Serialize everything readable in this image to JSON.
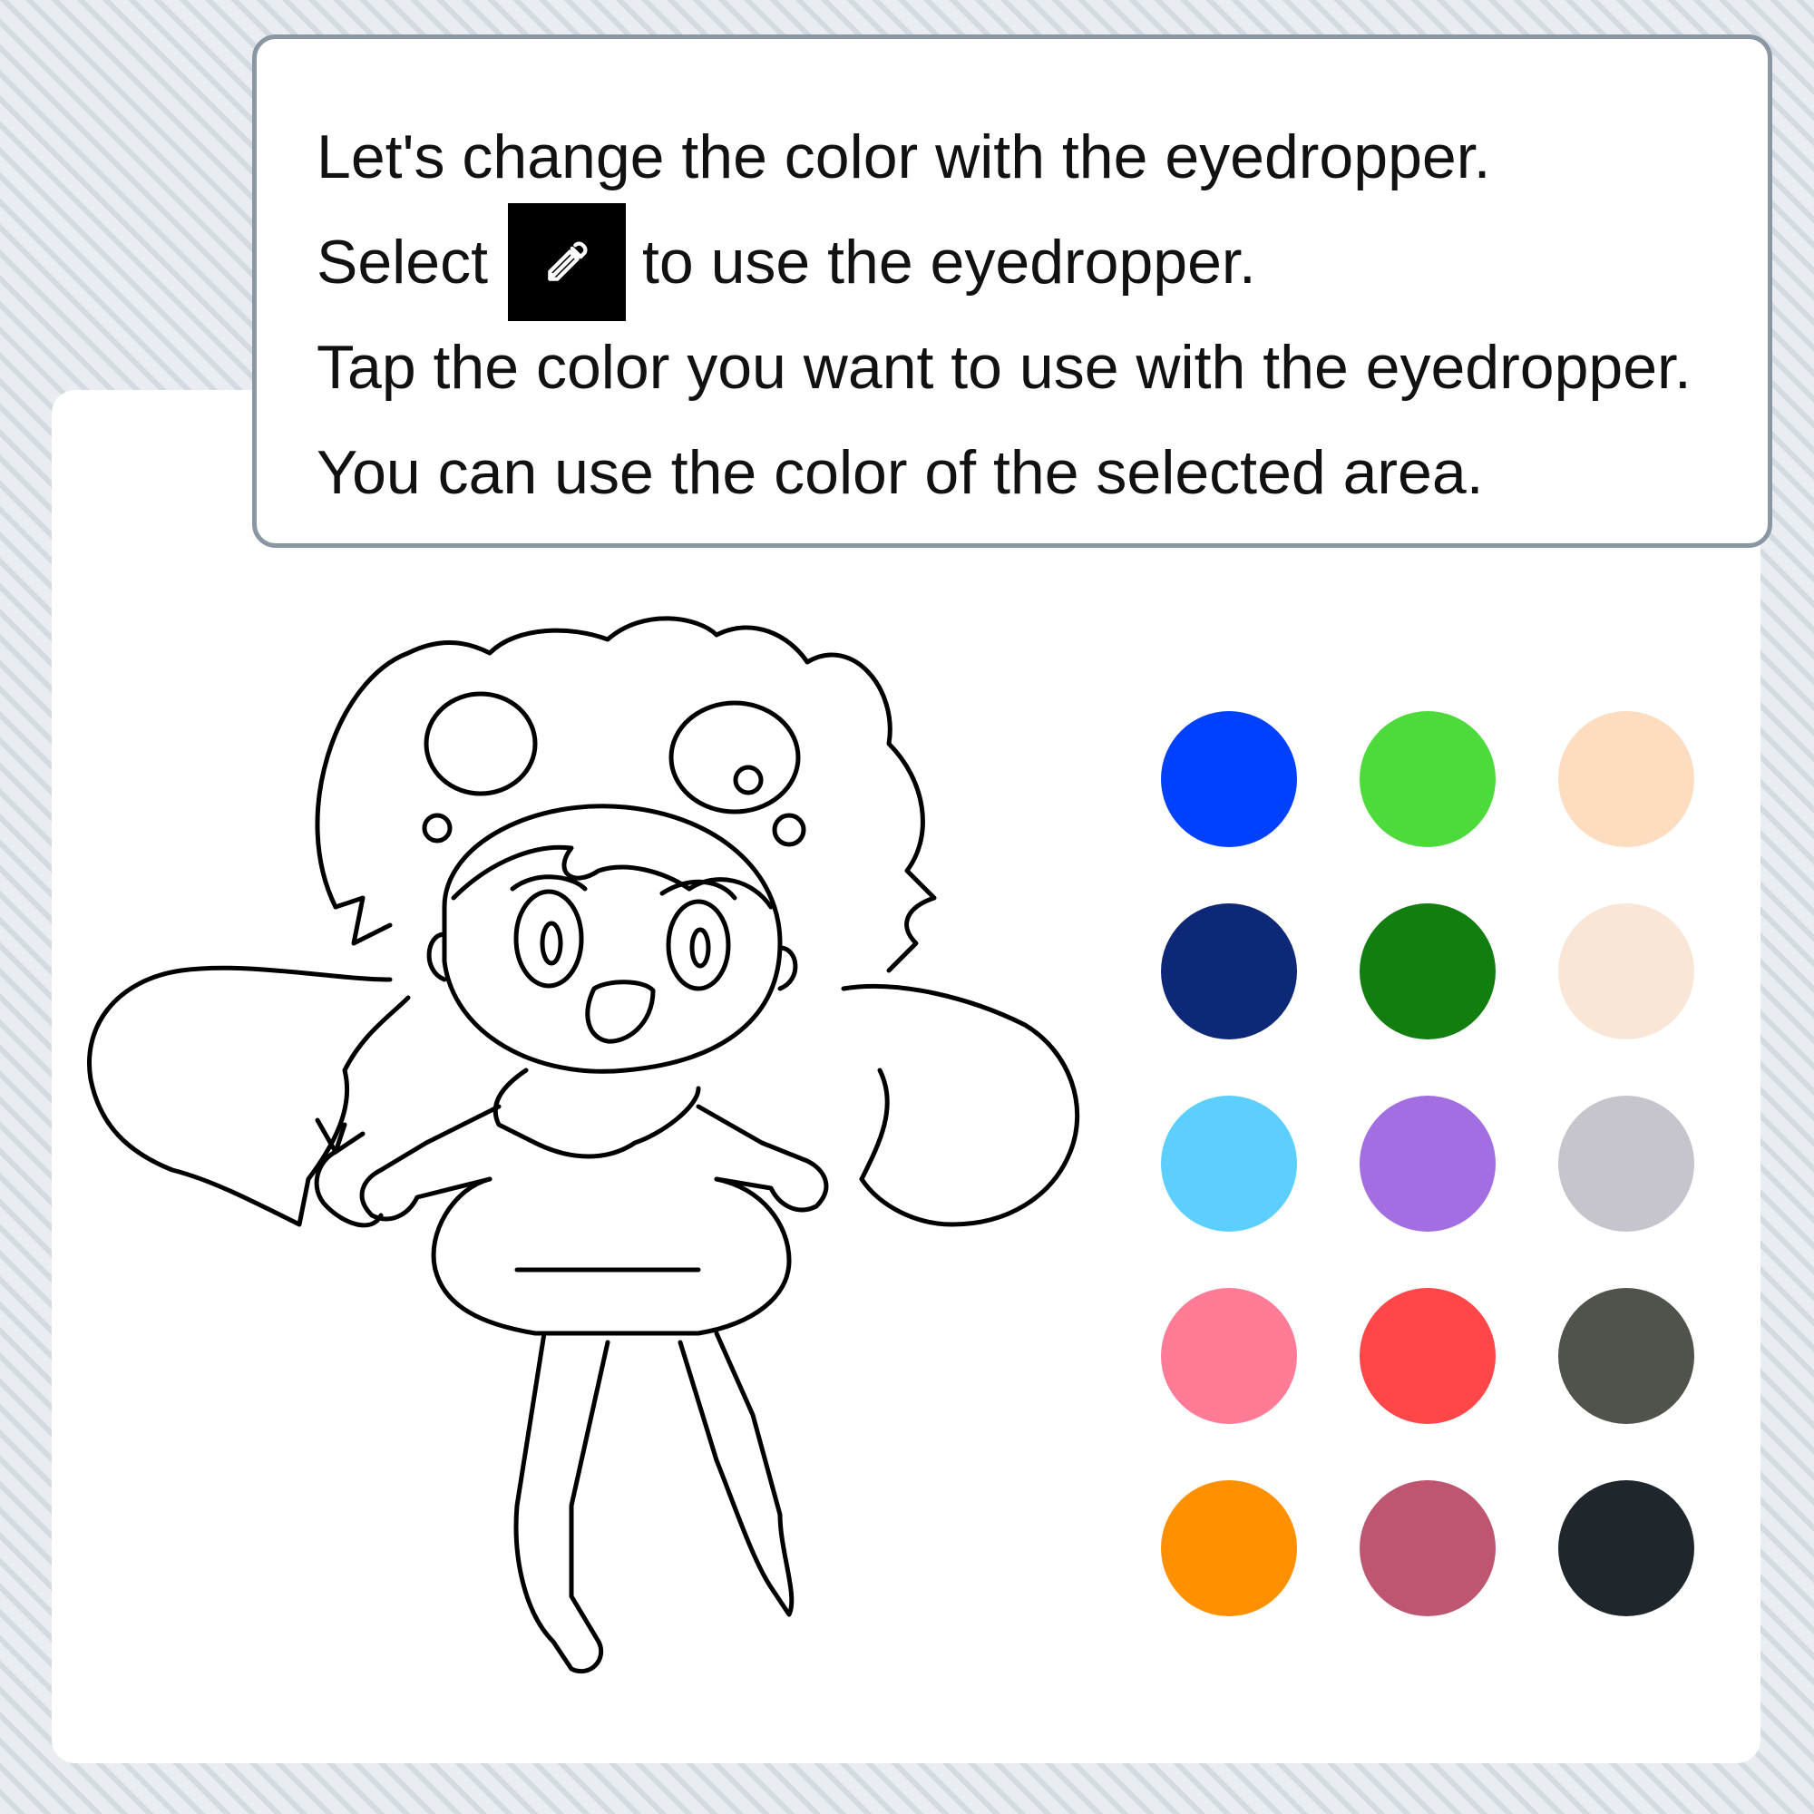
{
  "tooltip": {
    "line1": "Let's change the color with the eyedropper.",
    "line2_before": "Select",
    "line2_icon": "eyedropper-icon",
    "line2_after": "to use the eyedropper.",
    "line3": "Tap the color you want to use with the eyedropper.",
    "line4": "You can use the color of the selected area."
  },
  "palette": {
    "colors": [
      "#0040ff",
      "#4cdb3a",
      "#fddcbf",
      "#0d2877",
      "#137e10",
      "#fae6d6",
      "#5ccffe",
      "#a46ee3",
      "#c6c5cd",
      "#ff7b96",
      "#ff4648",
      "#4f534c",
      "#ff9100",
      "#be5672",
      "#1f272d"
    ]
  },
  "drawing": {
    "subject": "line-art-character"
  }
}
